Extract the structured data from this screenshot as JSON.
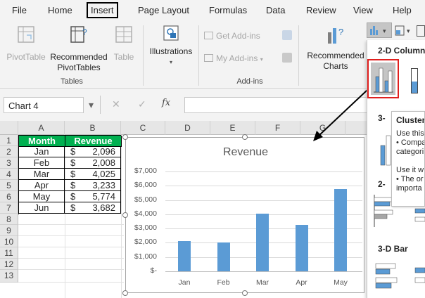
{
  "ribbon_tabs": [
    "File",
    "Home",
    "Insert",
    "Page Layout",
    "Formulas",
    "Data",
    "Review",
    "View",
    "Help"
  ],
  "ribbon": {
    "pivot_table": "PivotTable",
    "recommended_pivot": [
      "Recommended",
      "PivotTables"
    ],
    "table": "Table",
    "tables_group": "Tables",
    "illustrations": "Illustrations",
    "get_addins": "Get Add-ins",
    "my_addins": "My Add-ins",
    "addins_group": "Add-ins",
    "recommended_charts": [
      "Recommended",
      "Charts"
    ]
  },
  "formula_bar": {
    "name_box": "Chart 4",
    "fx": "fx",
    "content": ""
  },
  "columns": [
    "A",
    "B",
    "C",
    "D",
    "E",
    "F",
    "G"
  ],
  "rows": [
    "1",
    "2",
    "3",
    "4",
    "5",
    "6",
    "7",
    "8",
    "9",
    "10",
    "11",
    "12",
    "13"
  ],
  "table": {
    "headers": [
      "Month",
      "Revenue"
    ],
    "rows": [
      {
        "month": "Jan",
        "currency": "$",
        "value": "2,096"
      },
      {
        "month": "Feb",
        "currency": "$",
        "value": "2,008"
      },
      {
        "month": "Mar",
        "currency": "$",
        "value": "4,025"
      },
      {
        "month": "Apr",
        "currency": "$",
        "value": "3,233"
      },
      {
        "month": "May",
        "currency": "$",
        "value": "5,774"
      },
      {
        "month": "Jun",
        "currency": "$",
        "value": "3,682"
      }
    ],
    "header_color": "#00b050"
  },
  "chart_data": {
    "type": "bar",
    "title": "Revenue",
    "categories": [
      "Jan",
      "Feb",
      "Mar",
      "Apr",
      "May"
    ],
    "values": [
      2096,
      2008,
      4025,
      3233,
      5774
    ],
    "ylim": [
      0,
      7000
    ],
    "yticks": [
      "$7,000",
      "$6,000",
      "$5,000",
      "$4,000",
      "$3,000",
      "$2,000",
      "$1,000",
      "$-"
    ],
    "ytick_values": [
      7000,
      6000,
      5000,
      4000,
      3000,
      2000,
      1000,
      0
    ],
    "grid": true,
    "legend": "none",
    "bar_color": "#5b9bd5"
  },
  "dropdown": {
    "section_2d_column": "2-D Column",
    "section_3d": "3-",
    "section_2d": "2-",
    "section_3d_bar": "3-D Bar",
    "tooltip_title": "Clustere",
    "tooltip_lines": [
      "Use this",
      "• Compa",
      "categori",
      "",
      "Use it w",
      "• The or",
      "importa"
    ]
  },
  "accent_colors": {
    "selection_red": "#e0201e",
    "tab_outline": "#000000"
  }
}
